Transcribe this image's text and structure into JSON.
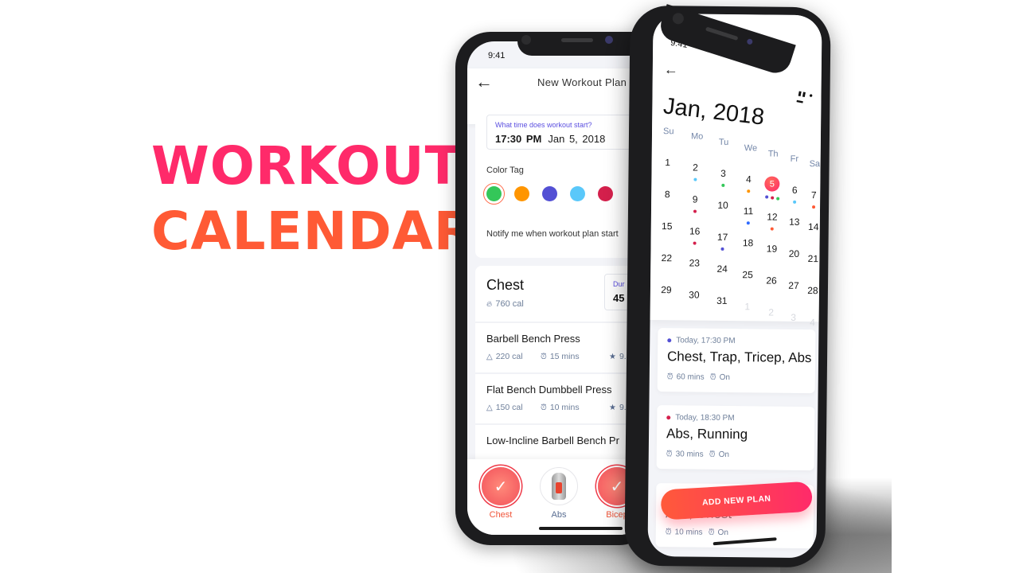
{
  "headline": {
    "line1": "WORKOUT",
    "line2": "CALENDAR"
  },
  "phone_plan": {
    "status_time": "9:41",
    "title": "New Workout Plan",
    "time_question": "What time does workout start?",
    "time_value": "17:30 PM",
    "date_value": "Jan 5, 2018",
    "color_tag_label": "Color Tag",
    "color_tags": [
      {
        "color": "#34c759",
        "selected": true
      },
      {
        "color": "#ff9500",
        "selected": false
      },
      {
        "color": "#5350d4",
        "selected": false
      },
      {
        "color": "#5ac8fa",
        "selected": false
      },
      {
        "color": "#d4204c",
        "selected": false
      }
    ],
    "notify_label": "Notify me when workout plan start",
    "group": {
      "name": "Chest",
      "calories": "760 cal",
      "duration_label": "Dur",
      "duration_value": "45"
    },
    "exercises": [
      {
        "name": "Barbell Bench Press",
        "calories": "220 cal",
        "duration": "15 mins",
        "rating": "9.4"
      },
      {
        "name": "Flat Bench Dumbbell Press",
        "calories": "150 cal",
        "duration": "10 mins",
        "rating": "9.4"
      },
      {
        "name": "Low-Incline Barbell Bench Pr"
      }
    ],
    "muscles": [
      {
        "label": "Chest",
        "selected": true
      },
      {
        "label": "Abs",
        "selected": false
      },
      {
        "label": "Bicep",
        "selected": true
      }
    ]
  },
  "phone_calendar": {
    "status_time": "9:41",
    "month_title": "Jan, 2018",
    "weekdays": [
      "Su",
      "Mo",
      "Tu",
      "We",
      "Th",
      "Fr",
      "Sa"
    ],
    "weeks": [
      [
        "1",
        "2",
        "3",
        "4",
        "5",
        "6",
        "7"
      ],
      [
        "8",
        "9",
        "10",
        "11",
        "12",
        "13",
        "14"
      ],
      [
        "15",
        "16",
        "17",
        "18",
        "19",
        "20",
        "21"
      ],
      [
        "22",
        "23",
        "24",
        "25",
        "26",
        "27",
        "28"
      ],
      [
        "29",
        "30",
        "31",
        "1",
        "2",
        "3",
        "4"
      ]
    ],
    "selected_day": "5",
    "day_dots": {
      "2": [
        "#5ac8fa"
      ],
      "3": [
        "#34c759"
      ],
      "4": [
        "#ff9500"
      ],
      "5": [
        "#5350d4",
        "#d4204c",
        "#34c759"
      ],
      "6": [
        "#5ac8fa"
      ],
      "7": [
        "#ff5a35"
      ],
      "9": [
        "#d4204c"
      ],
      "11": [
        "#2f6bff"
      ],
      "12": [
        "#ff5a35"
      ],
      "16": [
        "#d4204c"
      ],
      "17": [
        "#5350d4"
      ]
    },
    "events": [
      {
        "time": "Today, 17:30 PM",
        "dot": "#5350d4",
        "title": "Chest, Trap, Tricep, Abs",
        "duration": "60 mins",
        "alarm": "On"
      },
      {
        "time": "Today, 18:30 PM",
        "dot": "#d4204c",
        "title": "Abs, Running",
        "duration": "30 mins",
        "alarm": "On"
      },
      {
        "time": "",
        "dot": "",
        "title": "Abs, Chest",
        "duration": "10 mins",
        "alarm": "On"
      }
    ],
    "add_button": "ADD NEW PLAN"
  }
}
